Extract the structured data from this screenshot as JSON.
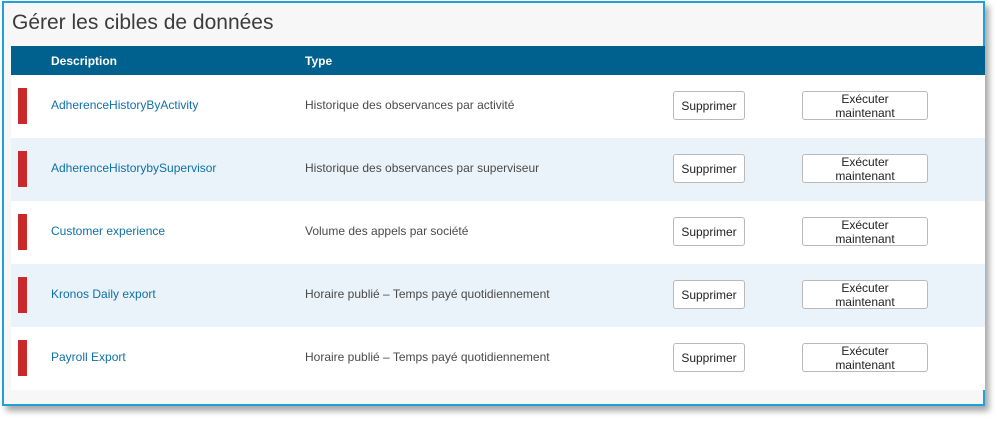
{
  "page": {
    "title": "Gérer les cibles de données"
  },
  "table": {
    "headers": {
      "description": "Description",
      "type": "Type"
    },
    "rows": [
      {
        "description": "AdherenceHistoryByActivity",
        "type": "Historique des observances par activité",
        "delete_label": "Supprimer",
        "run_label": "Exécuter maintenant"
      },
      {
        "description": "AdherenceHistorybySupervisor",
        "type": "Historique des observances par superviseur",
        "delete_label": "Supprimer",
        "run_label": "Exécuter maintenant"
      },
      {
        "description": "Customer experience",
        "type": "Volume des appels par société",
        "delete_label": "Supprimer",
        "run_label": "Exécuter maintenant"
      },
      {
        "description": "Kronos Daily export",
        "type": "Horaire publié – Temps payé quotidiennement",
        "delete_label": "Supprimer",
        "run_label": "Exécuter maintenant"
      },
      {
        "description": "Payroll Export",
        "type": "Horaire publié – Temps payé quotidiennement",
        "delete_label": "Supprimer",
        "run_label": "Exécuter maintenant"
      }
    ]
  },
  "colors": {
    "header_bg": "#00618f",
    "flag": "#c9292b",
    "link": "#1070a8",
    "alt_row": "#eaf3fa",
    "frame_border": "#1fa0d8"
  }
}
